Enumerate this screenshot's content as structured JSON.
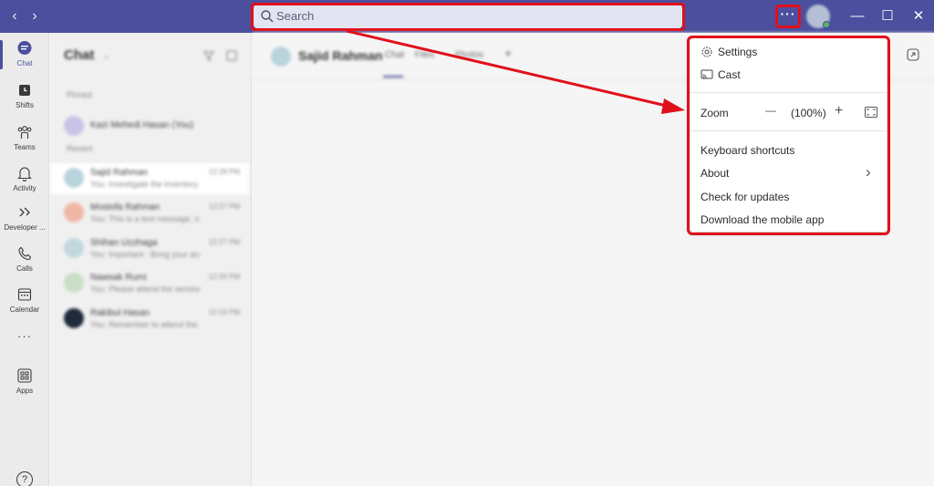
{
  "titlebar": {
    "back_glyph": "‹",
    "forward_glyph": "›",
    "search_placeholder": "Search",
    "more_glyph": "···",
    "minimize_glyph": "—",
    "maximize_glyph": "☐",
    "close_glyph": "✕"
  },
  "rail": {
    "items": [
      {
        "label": "Chat",
        "icon": "chat-icon"
      },
      {
        "label": "Shifts",
        "icon": "shifts-icon"
      },
      {
        "label": "Teams",
        "icon": "teams-icon"
      },
      {
        "label": "Activity",
        "icon": "bell-icon"
      },
      {
        "label": "Developer ...",
        "icon": "developer-icon"
      },
      {
        "label": "Calls",
        "icon": "phone-icon"
      },
      {
        "label": "Calendar",
        "icon": "calendar-icon"
      },
      {
        "label": "···",
        "icon": "more-apps-icon"
      },
      {
        "label": "Apps",
        "icon": "apps-icon"
      }
    ],
    "help_glyph": "?"
  },
  "chat_list": {
    "title": "Chat",
    "pinned_label": "Pinned",
    "recent_label": "Recent",
    "pinned": [
      {
        "name": "Kazi Mehedi Hasan (You)",
        "color": "#c9c3e6"
      }
    ],
    "recent": [
      {
        "name": "Sajid Rahman",
        "preview": "You: Investigate the inventory...",
        "time": "12:28 PM",
        "color": "#b9d4dd"
      },
      {
        "name": "Mostofa Rahman",
        "preview": "You: This is a test message, no...",
        "time": "12:27 PM",
        "color": "#f0b7a6"
      },
      {
        "name": "Shihan Uzzhaga",
        "preview": "You: Important : Bring your acc...",
        "time": "12:27 PM",
        "color": "#c3d8de"
      },
      {
        "name": "Nawsak Rumi",
        "preview": "You: Please attend the seminar...",
        "time": "12:26 PM",
        "color": "#c9dfc6"
      },
      {
        "name": "Rakibul Hasan",
        "preview": "You: Remember to attend the...",
        "time": "12:16 PM",
        "color": "#1f2a3a"
      }
    ]
  },
  "main": {
    "contact_name": "Sajid Rahman",
    "tabs": [
      "Chat",
      "Files",
      "Photos"
    ]
  },
  "menu": {
    "settings": "Settings",
    "cast": "Cast",
    "zoom": "Zoom",
    "zoom_minus": "—",
    "zoom_value": "(100%)",
    "zoom_plus": "+",
    "keyboard_shortcuts": "Keyboard shortcuts",
    "about": "About",
    "about_chevron": "›",
    "check_updates": "Check for updates",
    "download_mobile": "Download the mobile app"
  },
  "colors": {
    "accent": "#4b4f9e",
    "annotation_red": "#e0101a"
  }
}
